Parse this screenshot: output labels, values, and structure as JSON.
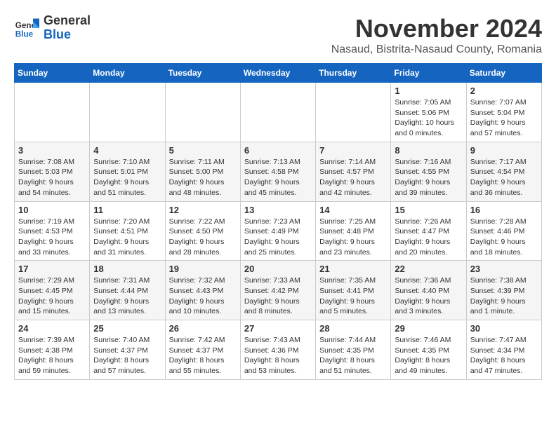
{
  "logo": {
    "line1": "General",
    "line2": "Blue"
  },
  "header": {
    "month": "November 2024",
    "location": "Nasaud, Bistrita-Nasaud County, Romania"
  },
  "weekdays": [
    "Sunday",
    "Monday",
    "Tuesday",
    "Wednesday",
    "Thursday",
    "Friday",
    "Saturday"
  ],
  "weeks": [
    [
      {
        "day": "",
        "info": ""
      },
      {
        "day": "",
        "info": ""
      },
      {
        "day": "",
        "info": ""
      },
      {
        "day": "",
        "info": ""
      },
      {
        "day": "",
        "info": ""
      },
      {
        "day": "1",
        "info": "Sunrise: 7:05 AM\nSunset: 5:06 PM\nDaylight: 10 hours\nand 0 minutes."
      },
      {
        "day": "2",
        "info": "Sunrise: 7:07 AM\nSunset: 5:04 PM\nDaylight: 9 hours\nand 57 minutes."
      }
    ],
    [
      {
        "day": "3",
        "info": "Sunrise: 7:08 AM\nSunset: 5:03 PM\nDaylight: 9 hours\nand 54 minutes."
      },
      {
        "day": "4",
        "info": "Sunrise: 7:10 AM\nSunset: 5:01 PM\nDaylight: 9 hours\nand 51 minutes."
      },
      {
        "day": "5",
        "info": "Sunrise: 7:11 AM\nSunset: 5:00 PM\nDaylight: 9 hours\nand 48 minutes."
      },
      {
        "day": "6",
        "info": "Sunrise: 7:13 AM\nSunset: 4:58 PM\nDaylight: 9 hours\nand 45 minutes."
      },
      {
        "day": "7",
        "info": "Sunrise: 7:14 AM\nSunset: 4:57 PM\nDaylight: 9 hours\nand 42 minutes."
      },
      {
        "day": "8",
        "info": "Sunrise: 7:16 AM\nSunset: 4:55 PM\nDaylight: 9 hours\nand 39 minutes."
      },
      {
        "day": "9",
        "info": "Sunrise: 7:17 AM\nSunset: 4:54 PM\nDaylight: 9 hours\nand 36 minutes."
      }
    ],
    [
      {
        "day": "10",
        "info": "Sunrise: 7:19 AM\nSunset: 4:53 PM\nDaylight: 9 hours\nand 33 minutes."
      },
      {
        "day": "11",
        "info": "Sunrise: 7:20 AM\nSunset: 4:51 PM\nDaylight: 9 hours\nand 31 minutes."
      },
      {
        "day": "12",
        "info": "Sunrise: 7:22 AM\nSunset: 4:50 PM\nDaylight: 9 hours\nand 28 minutes."
      },
      {
        "day": "13",
        "info": "Sunrise: 7:23 AM\nSunset: 4:49 PM\nDaylight: 9 hours\nand 25 minutes."
      },
      {
        "day": "14",
        "info": "Sunrise: 7:25 AM\nSunset: 4:48 PM\nDaylight: 9 hours\nand 23 minutes."
      },
      {
        "day": "15",
        "info": "Sunrise: 7:26 AM\nSunset: 4:47 PM\nDaylight: 9 hours\nand 20 minutes."
      },
      {
        "day": "16",
        "info": "Sunrise: 7:28 AM\nSunset: 4:46 PM\nDaylight: 9 hours\nand 18 minutes."
      }
    ],
    [
      {
        "day": "17",
        "info": "Sunrise: 7:29 AM\nSunset: 4:45 PM\nDaylight: 9 hours\nand 15 minutes."
      },
      {
        "day": "18",
        "info": "Sunrise: 7:31 AM\nSunset: 4:44 PM\nDaylight: 9 hours\nand 13 minutes."
      },
      {
        "day": "19",
        "info": "Sunrise: 7:32 AM\nSunset: 4:43 PM\nDaylight: 9 hours\nand 10 minutes."
      },
      {
        "day": "20",
        "info": "Sunrise: 7:33 AM\nSunset: 4:42 PM\nDaylight: 9 hours\nand 8 minutes."
      },
      {
        "day": "21",
        "info": "Sunrise: 7:35 AM\nSunset: 4:41 PM\nDaylight: 9 hours\nand 5 minutes."
      },
      {
        "day": "22",
        "info": "Sunrise: 7:36 AM\nSunset: 4:40 PM\nDaylight: 9 hours\nand 3 minutes."
      },
      {
        "day": "23",
        "info": "Sunrise: 7:38 AM\nSunset: 4:39 PM\nDaylight: 9 hours\nand 1 minute."
      }
    ],
    [
      {
        "day": "24",
        "info": "Sunrise: 7:39 AM\nSunset: 4:38 PM\nDaylight: 8 hours\nand 59 minutes."
      },
      {
        "day": "25",
        "info": "Sunrise: 7:40 AM\nSunset: 4:37 PM\nDaylight: 8 hours\nand 57 minutes."
      },
      {
        "day": "26",
        "info": "Sunrise: 7:42 AM\nSunset: 4:37 PM\nDaylight: 8 hours\nand 55 minutes."
      },
      {
        "day": "27",
        "info": "Sunrise: 7:43 AM\nSunset: 4:36 PM\nDaylight: 8 hours\nand 53 minutes."
      },
      {
        "day": "28",
        "info": "Sunrise: 7:44 AM\nSunset: 4:35 PM\nDaylight: 8 hours\nand 51 minutes."
      },
      {
        "day": "29",
        "info": "Sunrise: 7:46 AM\nSunset: 4:35 PM\nDaylight: 8 hours\nand 49 minutes."
      },
      {
        "day": "30",
        "info": "Sunrise: 7:47 AM\nSunset: 4:34 PM\nDaylight: 8 hours\nand 47 minutes."
      }
    ]
  ]
}
